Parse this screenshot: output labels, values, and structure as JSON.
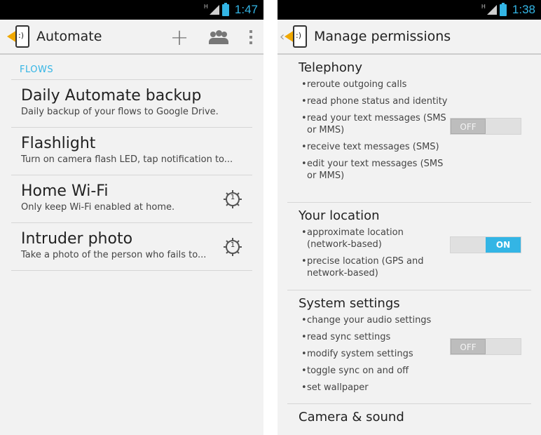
{
  "left": {
    "status": {
      "time": "1:47"
    },
    "app_title": "Automate",
    "section_header": "FLOWS",
    "flows": [
      {
        "title": "Daily Automate backup",
        "desc": "Daily backup of your flows to Google Drive.",
        "badge": ""
      },
      {
        "title": "Flashlight",
        "desc": "Turn on camera flash LED, tap notification to...",
        "badge": ""
      },
      {
        "title": "Home Wi-Fi",
        "desc": "Only keep Wi-Fi enabled at home.",
        "badge": "1"
      },
      {
        "title": "Intruder photo",
        "desc": "Take a photo of the person who fails to...",
        "badge": "1"
      }
    ]
  },
  "right": {
    "status": {
      "time": "1:38"
    },
    "title": "Manage permissions",
    "groups": [
      {
        "title": "Telephony",
        "items": [
          "reroute outgoing calls",
          "read phone status and identity",
          "read your text messages (SMS or MMS)",
          "receive text messages (SMS)",
          "edit your text messages (SMS or MMS)"
        ],
        "toggle": "OFF"
      },
      {
        "title": "Your location",
        "items": [
          "approximate location (network-based)",
          "precise location (GPS and network-based)"
        ],
        "toggle": "ON"
      },
      {
        "title": "System settings",
        "items": [
          "change your audio settings",
          "read sync settings",
          "modify system settings",
          "toggle sync on and off",
          "set wallpaper"
        ],
        "toggle": "OFF"
      },
      {
        "title": "Camera & sound",
        "items": [],
        "toggle": ""
      }
    ]
  },
  "colors": {
    "accent": "#33b5e5",
    "background": "#f2f2f2",
    "divider": "#d6d6d6"
  },
  "icons": {
    "add": "plus-icon",
    "community": "people-icon",
    "menu": "overflow-menu-icon",
    "app": "automate-app-icon",
    "flow_status": "gear-icon"
  }
}
